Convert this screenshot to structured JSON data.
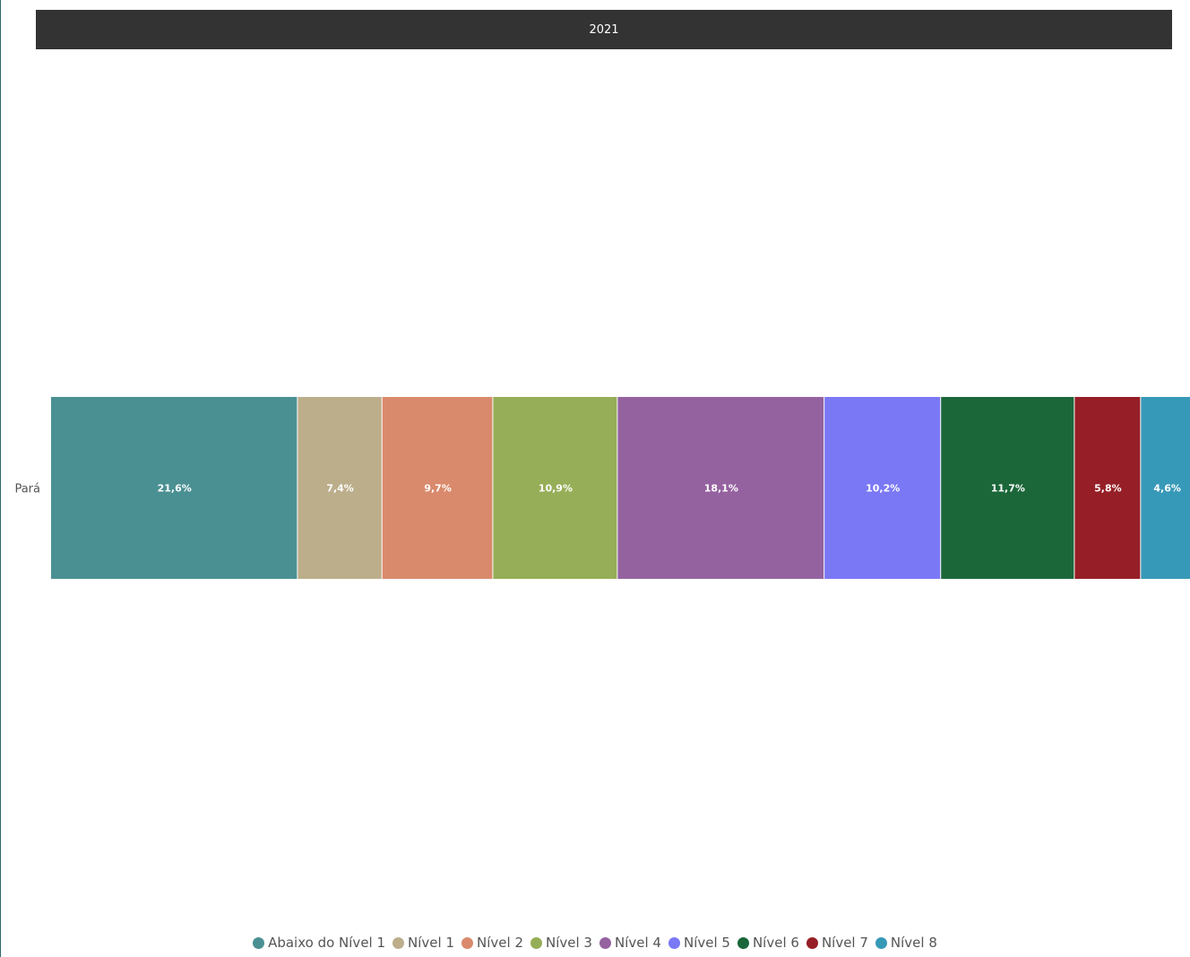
{
  "chart_data": {
    "type": "bar",
    "orientation": "horizontal",
    "stacked": true,
    "title": "2021",
    "categories": [
      "Pará"
    ],
    "series": [
      {
        "name": "Abaixo do Nível 1",
        "values": [
          21.6
        ],
        "label": "21,6%",
        "color": "#4a9093"
      },
      {
        "name": "Nível 1",
        "values": [
          7.4
        ],
        "label": "7,4%",
        "color": "#bcae8b"
      },
      {
        "name": "Nível 2",
        "values": [
          9.7
        ],
        "label": "9,7%",
        "color": "#da8a6c"
      },
      {
        "name": "Nível 3",
        "values": [
          10.9
        ],
        "label": "10,9%",
        "color": "#96ae57"
      },
      {
        "name": "Nível 4",
        "values": [
          18.1
        ],
        "label": "18,1%",
        "color": "#9562a0"
      },
      {
        "name": "Nível 5",
        "values": [
          10.2
        ],
        "label": "10,2%",
        "color": "#7a78f5"
      },
      {
        "name": "Nível 6",
        "values": [
          11.7
        ],
        "label": "11,7%",
        "color": "#1b673a"
      },
      {
        "name": "Nível 7",
        "values": [
          5.8
        ],
        "label": "5,8%",
        "color": "#961f27"
      },
      {
        "name": "Nível 8",
        "values": [
          4.6
        ],
        "label": "4,6%",
        "color": "#3799b8"
      }
    ],
    "legend": "bottom-center",
    "grid": false
  }
}
